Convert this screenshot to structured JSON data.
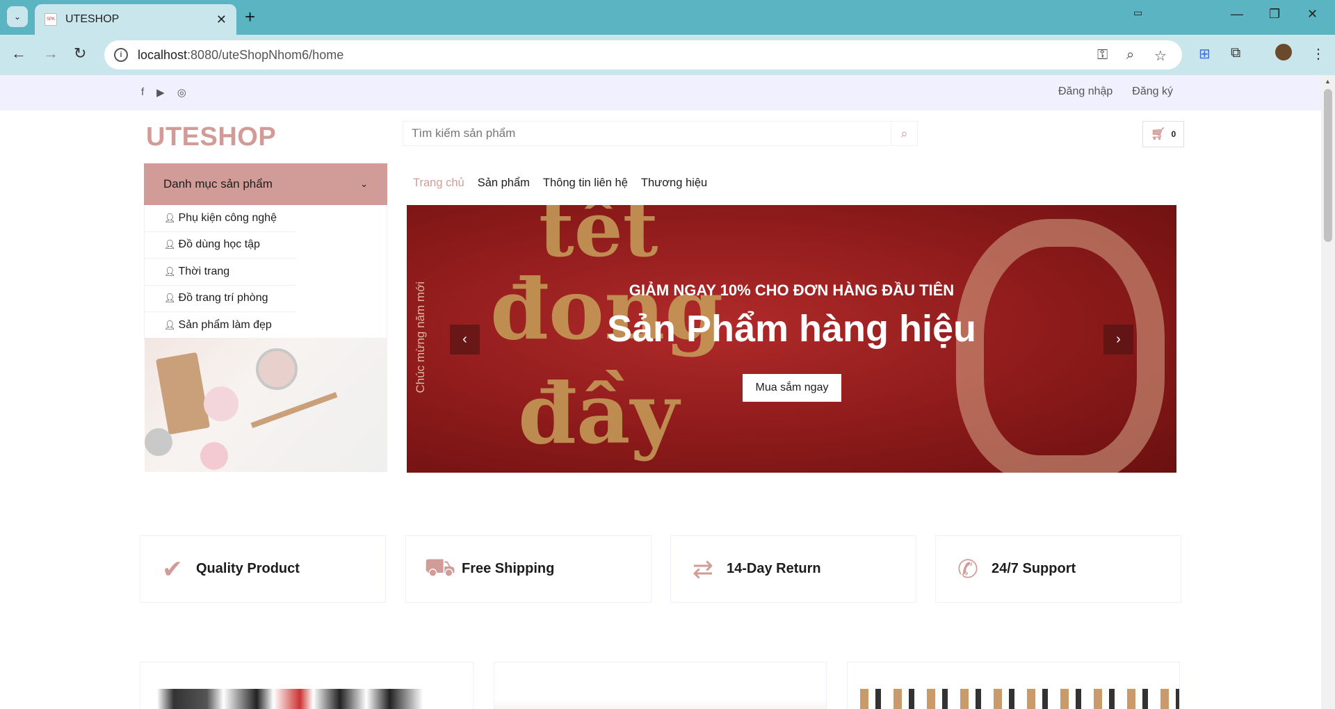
{
  "browser": {
    "tab_title": "UTESHOP",
    "url_host": "localhost",
    "url_path": ":8080/uteShopNhom6/home"
  },
  "topbar": {
    "social_icons": [
      "facebook-icon",
      "youtube-icon",
      "instagram-icon"
    ],
    "login": "Đăng nhập",
    "register": "Đăng ký"
  },
  "header": {
    "logo": "UTESHOP",
    "search_placeholder": "Tìm kiếm sản phẩm",
    "cart_count": "0"
  },
  "sidebar": {
    "heading": "Danh mục sản phẩm",
    "items": [
      {
        "label": "Phụ kiện công nghệ"
      },
      {
        "label": "Đồ dùng học tập"
      },
      {
        "label": "Thời trang"
      },
      {
        "label": "Đồ trang trí phòng"
      },
      {
        "label": "Sản phẩm làm đẹp"
      }
    ]
  },
  "nav": {
    "items": [
      {
        "label": "Trang chủ",
        "active": true
      },
      {
        "label": "Sản phẩm"
      },
      {
        "label": "Thông tin liên hệ"
      },
      {
        "label": "Thương hiệu"
      }
    ]
  },
  "banner": {
    "vertical_text": "Chúc mừng năm mới",
    "subheading": "GIẢM NGAY 10% CHO ĐƠN HÀNG ĐẦU TIÊN",
    "heading": "Sản Phẩm hàng hiệu",
    "cta": "Mua sắm ngay",
    "deco_line1": "tết",
    "deco_line2": "đong",
    "deco_line3": "đầy"
  },
  "features": [
    {
      "label": "Quality Product",
      "icon": "check-icon"
    },
    {
      "label": "Free Shipping",
      "icon": "truck-icon"
    },
    {
      "label": "14-Day Return",
      "icon": "exchange-icon"
    },
    {
      "label": "24/7 Support",
      "icon": "phone-icon"
    }
  ],
  "colors": {
    "primary": "#d19c97",
    "topbar_bg": "#f0f0ff",
    "banner_red": "#9c1f1f"
  }
}
